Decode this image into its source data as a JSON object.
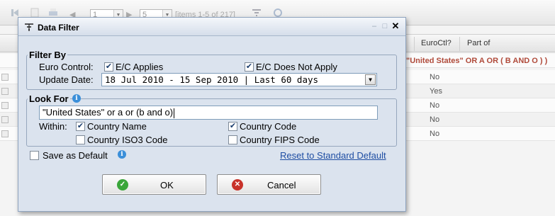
{
  "toolbar": {
    "page_select": "1",
    "page_size_select": "5",
    "items_info": "[items 1-5 of 217]"
  },
  "grid": {
    "headers": {
      "euro_ctl": "EuroCtl?",
      "part_of": "Part of"
    },
    "filter_summary": "\"United States\" OR A OR ( B AND O ) )",
    "rows": [
      "No",
      "Yes",
      "No",
      "No",
      "No"
    ]
  },
  "dialog": {
    "title": "Data Filter",
    "filter_by": {
      "legend": "Filter By",
      "euro_control_label": "Euro Control:",
      "ec_applies_label": "E/C Applies",
      "ec_applies_checked": true,
      "ec_not_apply_label": "E/C Does Not Apply",
      "ec_not_apply_checked": true,
      "update_date_label": "Update Date:",
      "update_date_value": "18 Jul 2010 - 15 Sep 2010 | Last 60 days"
    },
    "look_for": {
      "legend": "Look For",
      "search_value": "\"United States\" or a or (b and o)",
      "within_label": "Within:",
      "country_name_label": "Country Name",
      "country_name_checked": true,
      "country_code_label": "Country Code",
      "country_code_checked": true,
      "country_iso3_label": "Country ISO3 Code",
      "country_iso3_checked": false,
      "country_fips_label": "Country FIPS Code",
      "country_fips_checked": false
    },
    "save_default_label": "Save as Default",
    "save_default_checked": false,
    "reset_link": "Reset to Standard Default",
    "ok_label": "OK",
    "cancel_label": "Cancel"
  }
}
